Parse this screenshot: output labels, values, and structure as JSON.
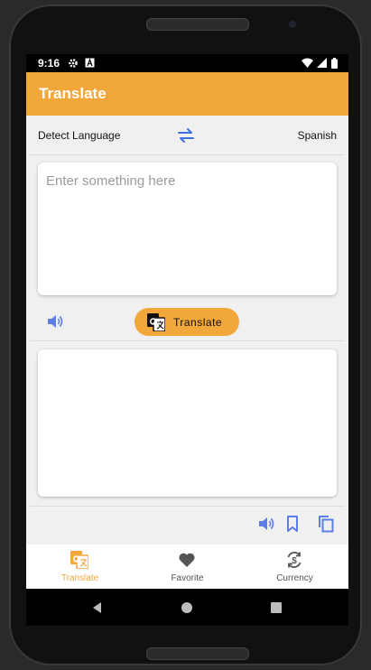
{
  "status_bar": {
    "time": "9:16",
    "icons": [
      "gear-icon",
      "a-icon",
      "wifi-icon",
      "signal-icon",
      "battery-icon"
    ]
  },
  "app_bar": {
    "title": "Translate"
  },
  "languages": {
    "source": "Detect Language",
    "target": "Spanish",
    "swap_icon": "swap-arrows-icon"
  },
  "input": {
    "placeholder": "Enter something here",
    "value": ""
  },
  "translate_button": {
    "label": "Translate",
    "icon": "google-translate-icon"
  },
  "output": {
    "text": ""
  },
  "output_actions": [
    "speaker-icon",
    "bookmark-icon",
    "copy-icon"
  ],
  "bottom_nav": {
    "items": [
      {
        "label": "Translate",
        "icon": "translate-icon",
        "active": true
      },
      {
        "label": "Favorite",
        "icon": "heart-icon",
        "active": false
      },
      {
        "label": "Currency",
        "icon": "currency-exchange-icon",
        "active": false
      }
    ]
  },
  "system_nav": [
    "back-icon",
    "home-icon",
    "recents-icon"
  ],
  "colors": {
    "accent": "#f2a73b",
    "icon_blue": "#5b7ee8",
    "background": "#f0f0f0"
  }
}
